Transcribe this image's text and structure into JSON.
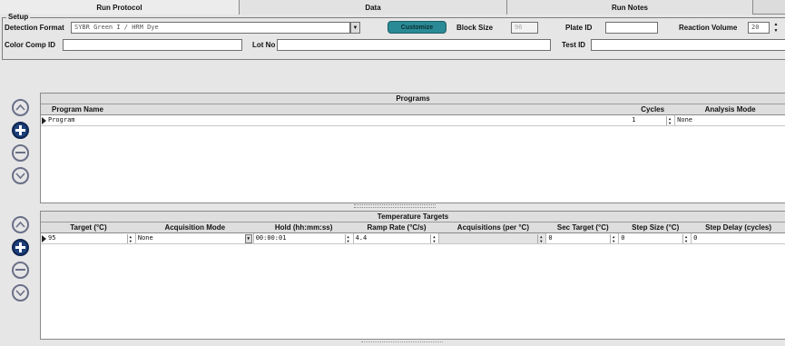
{
  "tabs": [
    {
      "label": "Run Protocol",
      "active": true
    },
    {
      "label": "Data",
      "active": false
    },
    {
      "label": "Run Notes",
      "active": false
    }
  ],
  "setup": {
    "legend": "Setup",
    "detection_format_label": "Detection Format",
    "detection_format_value": "SYBR Green I / HRM Dye",
    "customize_label": "Customize",
    "block_size_label": "Block Size",
    "block_size_value": "96",
    "plate_id_label": "Plate ID",
    "plate_id_value": "",
    "reaction_volume_label": "Reaction Volume",
    "reaction_volume_value": "20",
    "color_comp_label": "Color Comp ID",
    "color_comp_value": "",
    "lot_no_label": "Lot No",
    "lot_no_value": "",
    "test_id_label": "Test ID",
    "test_id_value": ""
  },
  "programs": {
    "title": "Programs",
    "columns": [
      "Program Name",
      "Cycles",
      "Analysis Mode"
    ],
    "rows": [
      {
        "name": "Program",
        "cycles": "1",
        "analysis_mode": "None"
      }
    ]
  },
  "targets": {
    "title": "Temperature Targets",
    "columns": [
      "Target (°C)",
      "Acquisition Mode",
      "Hold (hh:mm:ss)",
      "Ramp Rate (°C/s)",
      "Acquisitions (per °C)",
      "Sec Target (°C)",
      "Step Size (°C)",
      "Step Delay (cycles)"
    ],
    "rows": [
      {
        "target": "95",
        "acquisition_mode": "None",
        "hold": "00:00:01",
        "ramp_rate": "4.4",
        "acquisitions": "",
        "sec_target": "0",
        "step_size": "0",
        "step_delay": "0"
      }
    ]
  },
  "icons": {
    "up": "chevron-up-icon",
    "add": "plus-icon",
    "remove": "minus-icon",
    "down": "chevron-down-icon"
  },
  "colors": {
    "customize_button": "#2a8a95",
    "add_button": "#1d3f7a"
  }
}
